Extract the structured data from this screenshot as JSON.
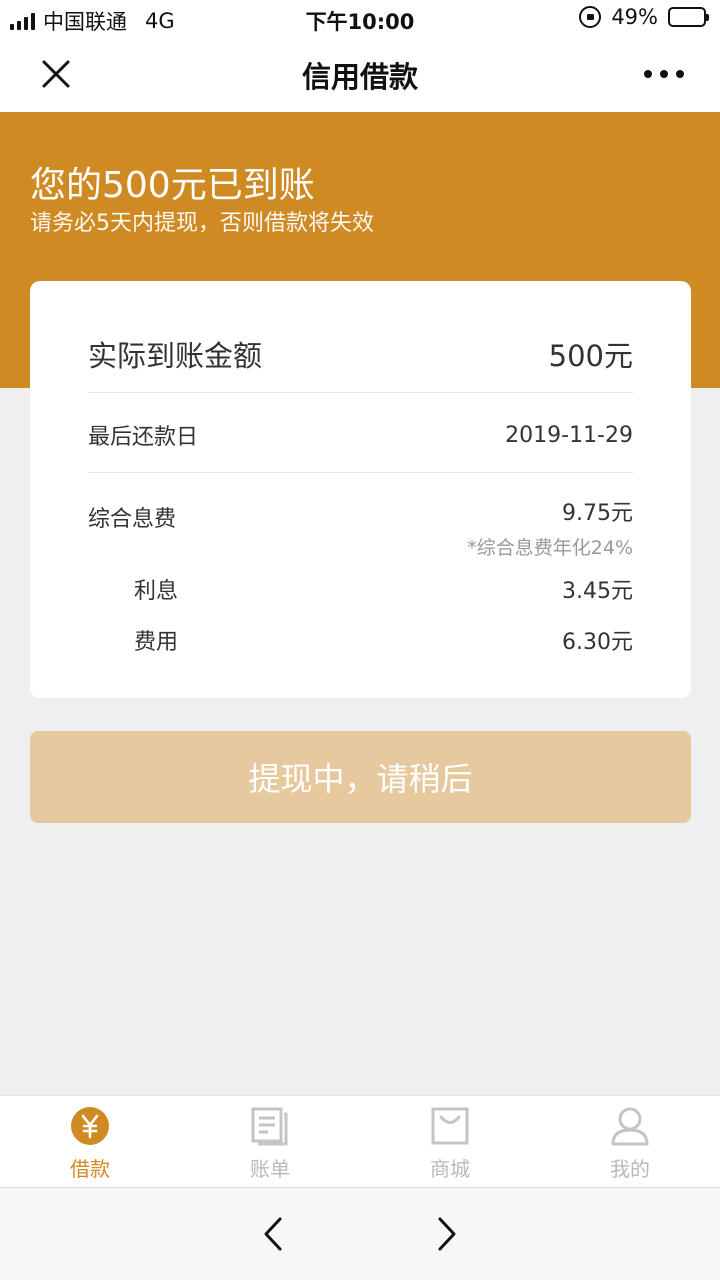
{
  "status_bar": {
    "carrier": "中国联通",
    "network": "4G",
    "time": "下午10:00",
    "battery": "49%",
    "battery_level": 0.49
  },
  "nav": {
    "title": "信用借款"
  },
  "banner": {
    "title": "您的500元已到账",
    "subtitle": "请务必5天内提现，否则借款将失效"
  },
  "card": {
    "amount_label": "实际到账金额",
    "amount_value": "500元",
    "due_label": "最后还款日",
    "due_value": "2019-11-29",
    "fee_label": "综合息费",
    "fee_value": "9.75元",
    "fee_note": "*综合息费年化24%",
    "interest_label": "利息",
    "interest_value": "3.45元",
    "charge_label": "费用",
    "charge_value": "6.30元"
  },
  "withdraw_button": {
    "label": "提现中，请稍后"
  },
  "tabs": [
    {
      "label": "借款",
      "icon": "yuan-icon",
      "active": true
    },
    {
      "label": "账单",
      "icon": "bill-icon",
      "active": false
    },
    {
      "label": "商城",
      "icon": "shop-icon",
      "active": false
    },
    {
      "label": "我的",
      "icon": "user-icon",
      "active": false
    }
  ],
  "colors": {
    "accent": "#cf8a24",
    "button_disabled": "#e6c99e",
    "inactive_tab": "#b9b9b9"
  }
}
